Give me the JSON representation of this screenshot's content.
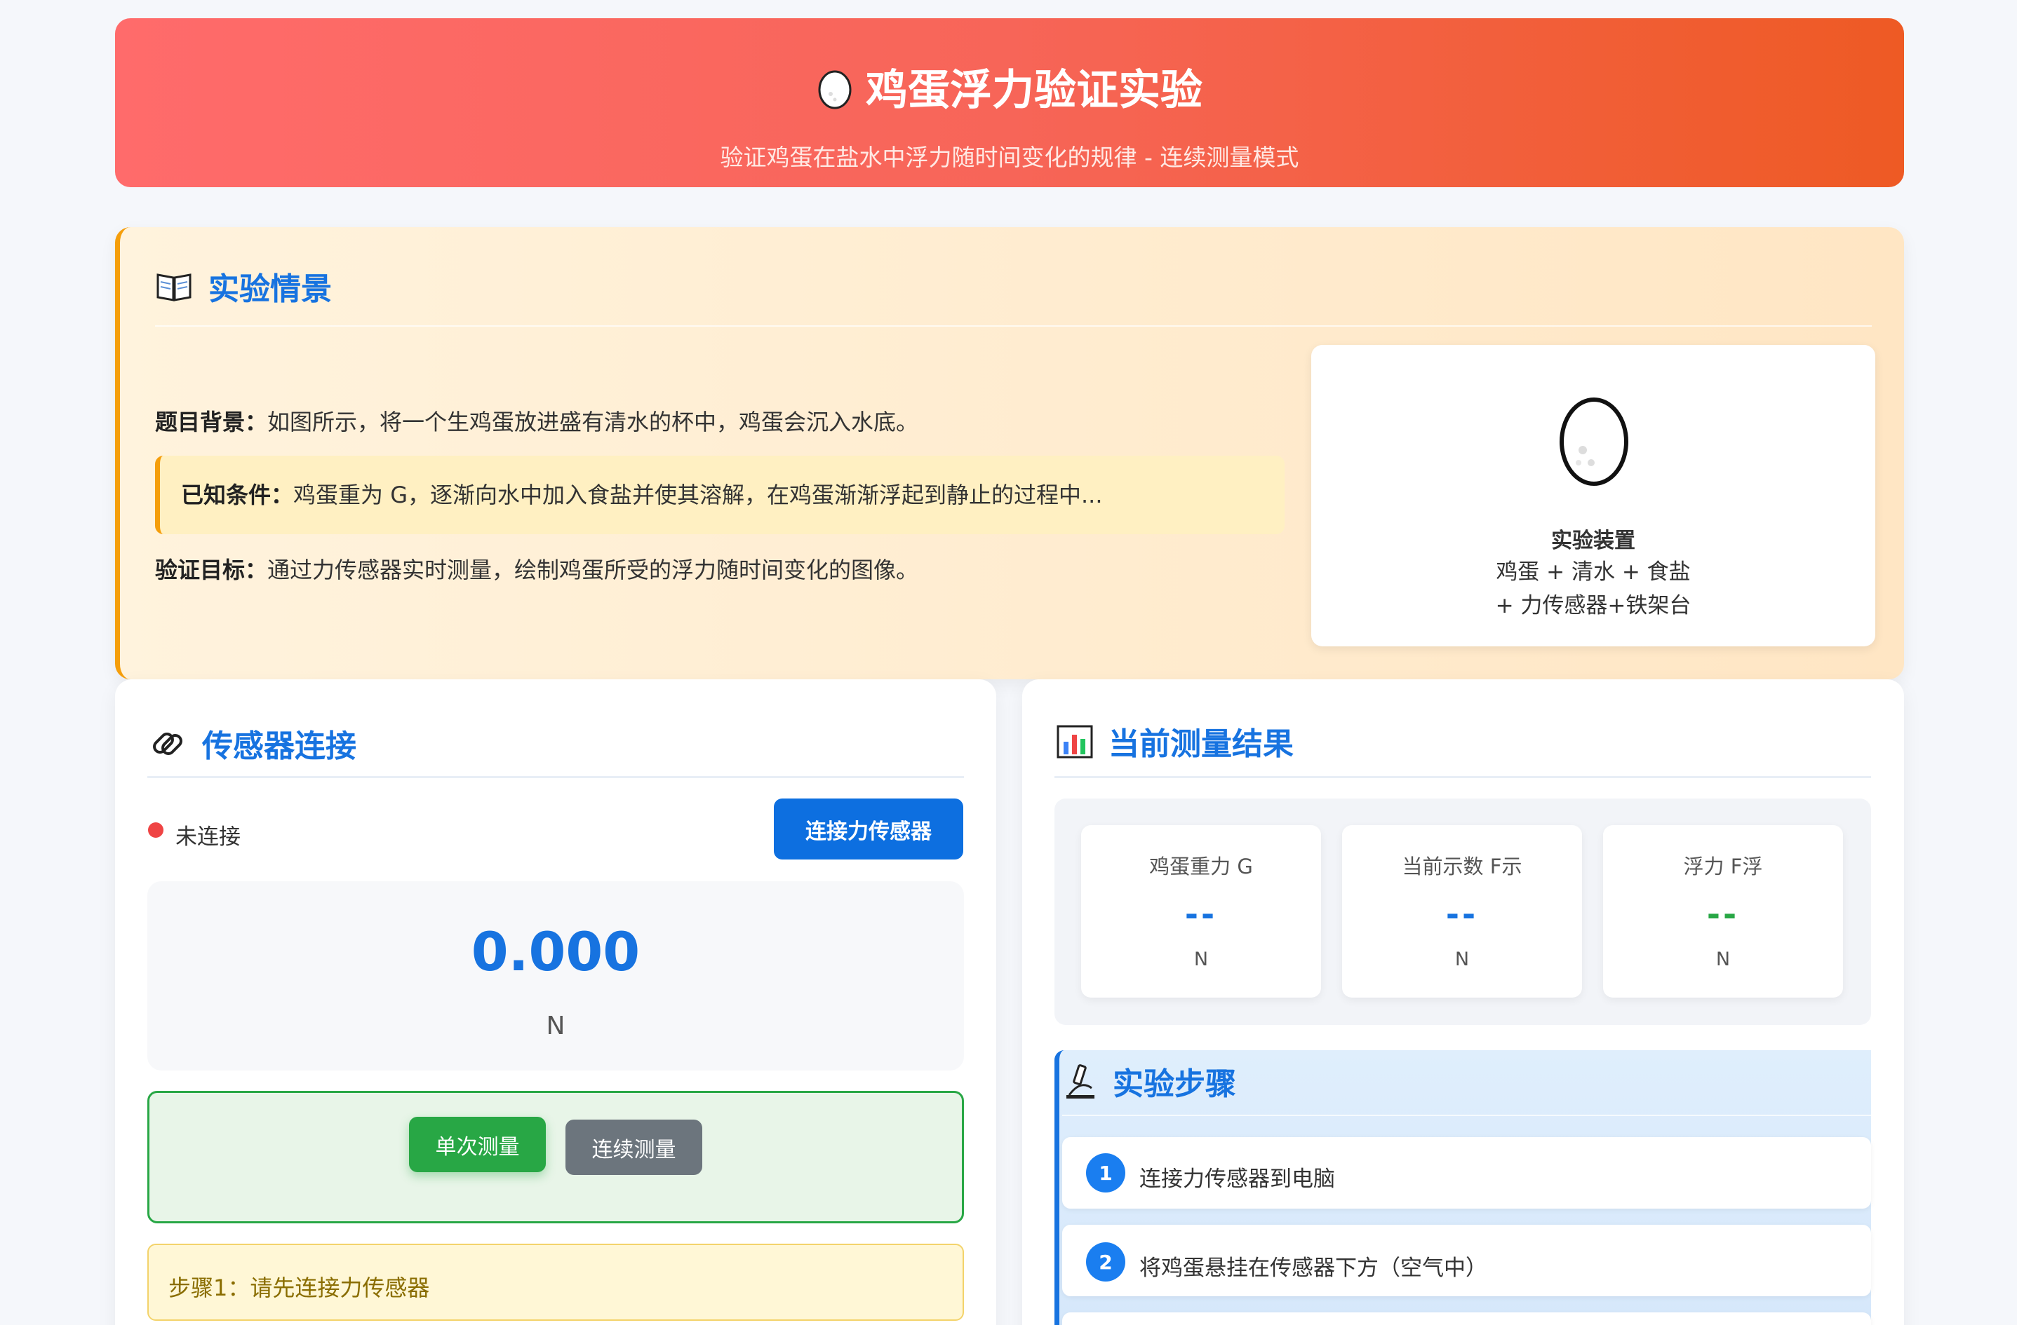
{
  "header": {
    "title": "鸡蛋浮力验证实验",
    "subtitle": "验证鸡蛋在盐水中浮力随时间变化的规律 - 连续测量模式",
    "icon": "egg-icon"
  },
  "scenario": {
    "title": "实验情景",
    "icon": "book-icon",
    "background_label": "题目背景：",
    "background_text": "如图所示，将一个生鸡蛋放进盛有清水的杯中，鸡蛋会沉入水底。",
    "known_label": "已知条件：",
    "known_text": "鸡蛋重为 G，逐渐向水中加入食盐并使其溶解，在鸡蛋渐渐浮起到静止的过程中...",
    "goal_label": "验证目标：",
    "goal_text": "通过力传感器实时测量，绘制鸡蛋所受的浮力随时间变化的图像。",
    "device": {
      "icon": "egg-outline-icon",
      "title": "实验装置",
      "line1": "鸡蛋 + 清水 + 食盐",
      "line2": "+ 力传感器+铁架台"
    }
  },
  "sensor": {
    "title": "传感器连接",
    "icon": "link-icon",
    "status": "未连接",
    "status_color": "#ef4444",
    "connect_button": "连接力传感器",
    "reading_value": "0.000",
    "reading_unit": "N",
    "single_button": "单次测量",
    "continuous_button": "连续测量",
    "hint": "步骤1：请先连接力传感器"
  },
  "results": {
    "title": "当前测量结果",
    "icon": "bar-chart-icon",
    "metrics": [
      {
        "label": "鸡蛋重力 G",
        "value": "--",
        "unit": "N",
        "color": "#1773e0"
      },
      {
        "label": "当前示数 F示",
        "value": "--",
        "unit": "N",
        "color": "#1773e0"
      },
      {
        "label": "浮力 F浮",
        "value": "--",
        "unit": "N",
        "color": "#28a745"
      }
    ]
  },
  "steps": {
    "title": "实验步骤",
    "icon": "microscope-icon",
    "items": [
      {
        "num": "1",
        "text": "连接力传感器到电脑"
      },
      {
        "num": "2",
        "text": "将鸡蛋悬挂在传感器下方（空气中）"
      }
    ]
  }
}
